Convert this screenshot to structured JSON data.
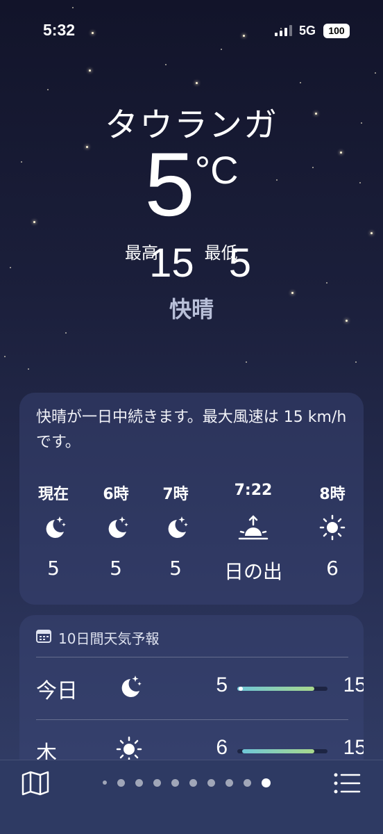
{
  "status_bar": {
    "time": "5:32",
    "network": "5G",
    "battery": "100"
  },
  "location": {
    "city": "タウランガ",
    "temperature": "5",
    "unit": "°C",
    "high_label": "最高",
    "high": "15",
    "low_label": "最低",
    "low": "5",
    "condition": "快晴"
  },
  "hourly": {
    "summary": "快晴が一日中続きます。最大風速は 15 km/h です。",
    "items": [
      {
        "label": "現在",
        "icon": "moon-stars-icon",
        "value": "5"
      },
      {
        "label": "6時",
        "icon": "moon-stars-icon",
        "value": "5"
      },
      {
        "label": "7時",
        "icon": "moon-stars-icon",
        "value": "5"
      },
      {
        "label": "7:22",
        "icon": "sunrise-icon",
        "value": "日の出"
      },
      {
        "label": "8時",
        "icon": "sun-icon",
        "value": "6"
      }
    ]
  },
  "daily": {
    "header": "10日間天気予報",
    "header_icon": "calendar-icon",
    "days": [
      {
        "day": "今日",
        "icon": "moon-stars-icon",
        "low": "5",
        "high": "15",
        "bar_start": 0.0,
        "bar_end": 0.85
      },
      {
        "day": "木",
        "icon": "sun-icon",
        "low": "6",
        "high": "15",
        "bar_start": 0.05,
        "bar_end": 0.85
      }
    ]
  },
  "bottom_bar": {
    "left_icon": "map-icon",
    "right_icon": "list-icon",
    "page_count": 10,
    "active_page": 10
  },
  "colors": {
    "background_top": "#12142a",
    "background_bottom": "#34406a",
    "temp_bar_start": "#6fc6d8",
    "temp_bar_end": "#a8d88c",
    "condition_text": "#b8bfd8"
  }
}
